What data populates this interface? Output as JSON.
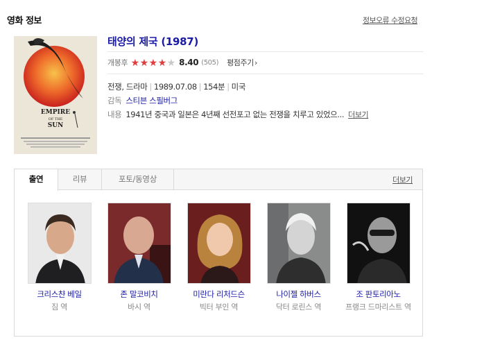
{
  "section_title": "영화 정보",
  "report_link": "정보오류 수정요청",
  "movie": {
    "title": "태양의 제국 (1987)",
    "rating_label": "개봉후",
    "stars_filled": 4,
    "stars_total": 5,
    "score": "8.40",
    "votes": "(505)",
    "rate_link": "평점주기",
    "genre": "전쟁, 드라마",
    "release_date": "1989.07.08",
    "runtime": "154분",
    "country": "미국",
    "director_label": "감독",
    "director": "스티븐 스필버그",
    "summary_label": "내용",
    "summary": "1941년 중국과 일본은 4년째 선전포고 없는 전쟁을 치루고 있었으...",
    "summary_more": "더보기"
  },
  "tabs": [
    {
      "label": "출연",
      "active": true
    },
    {
      "label": "리뷰",
      "active": false
    },
    {
      "label": "포토/동영상",
      "active": false
    }
  ],
  "tabs_more": "더보기",
  "cast": [
    {
      "name": "크리스챤 베일",
      "role": "짐 역"
    },
    {
      "name": "존 말코비치",
      "role": "바시 역"
    },
    {
      "name": "미란다 리처드슨",
      "role": "빅터 부인 역"
    },
    {
      "name": "나이젤 하버스",
      "role": "닥터 로린스 역"
    },
    {
      "name": "조 판토리아노",
      "role": "프랭크 드마리스트 역"
    }
  ],
  "poster_text": "EMPIRE OF THE SUN",
  "colors": {
    "link_blue": "#1a1aa6",
    "star_red": "#e23c3c"
  }
}
